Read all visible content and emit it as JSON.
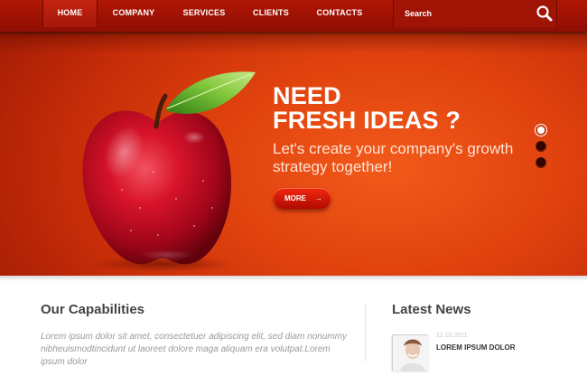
{
  "nav": {
    "items": [
      {
        "label": "HOME",
        "active": true
      },
      {
        "label": "COMPANY",
        "active": false
      },
      {
        "label": "SERVICES",
        "active": false
      },
      {
        "label": "CLIENTS",
        "active": false
      },
      {
        "label": "CONTACTS",
        "active": false
      }
    ],
    "search": {
      "placeholder": "Search",
      "icon": "search-icon"
    }
  },
  "hero": {
    "headline_line1": "NEED",
    "headline_line2": "FRESH IDEAS ?",
    "subline": "Let's create your company's growth strategy together!",
    "more_label": "MORE",
    "more_arrow": "→",
    "image": "red-apple",
    "slider": {
      "total": 3,
      "active_index": 0
    },
    "colors": {
      "accent": "#e0420e",
      "nav": "#a01406"
    }
  },
  "capabilities": {
    "title": "Our Capabilities",
    "text": "Lorem ipsum dolor sit amet, consectetuer adipiscing elit, sed diam nonummy nibheuismodtincidunt ut laoreet dolore maga aliquam era volutpat.Lorem ipsum dolor"
  },
  "news": {
    "title": "Latest News",
    "items": [
      {
        "date": "12.10.2011",
        "title": "LOREM IPSUM DOLOR"
      }
    ]
  }
}
